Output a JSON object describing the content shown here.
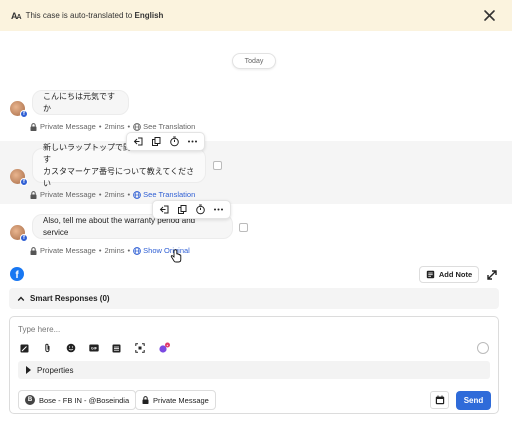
{
  "banner": {
    "icon": "translate-icon",
    "text_prefix": "This case is auto-translated to ",
    "language": "English"
  },
  "today_label": "Today",
  "messages": [
    {
      "text_lines": [
        "こんにちは元気ですか"
      ],
      "meta_type": "Private Message",
      "meta_time": "2mins",
      "meta_link": "See Translation",
      "link_active": false
    },
    {
      "text_lines": [
        "新しいラップトップで問題に直面しています",
        "カスタマーケア番号について教えてください"
      ],
      "meta_type": "Private Message",
      "meta_time": "2mins",
      "meta_link": "See Translation",
      "link_active": true
    },
    {
      "text_lines": [
        "Also, tell me about the warranty period and service"
      ],
      "meta_type": "Private Message",
      "meta_time": "2mins",
      "meta_link": "Show Original",
      "link_active": true
    }
  ],
  "meta_separator": "•",
  "bottom_bar": {
    "add_note_label": "Add Note"
  },
  "smart_responses": {
    "label": "Smart Responses (0)"
  },
  "composer": {
    "placeholder": "Type here...",
    "properties_label": "Properties",
    "account_chip": "Bose - FB IN - @Boseindia",
    "message_type_chip": "Private Message",
    "send_label": "Send"
  },
  "colors": {
    "accent": "#2f6bd9",
    "banner_bg": "#fbf3de",
    "facebook": "#1877f2"
  }
}
